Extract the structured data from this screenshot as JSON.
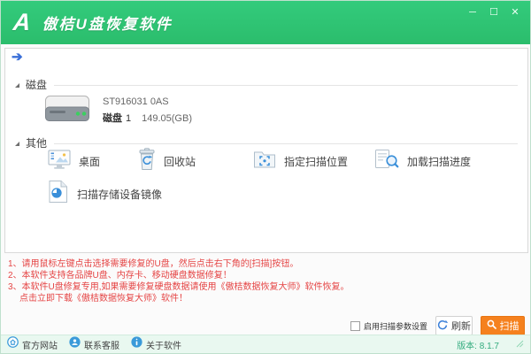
{
  "window": {
    "logo": "A",
    "title": "傲桔U盘恢复软件",
    "controls": {
      "minimize": "─",
      "maximize": "☐",
      "close": "✕"
    }
  },
  "toolbar": {
    "forward_arrow": "➔"
  },
  "sections": {
    "disk": {
      "label": "磁盘",
      "device": {
        "model": "ST916031 0AS",
        "disk_label": "磁盘",
        "disk_number": "1",
        "capacity": "149.05(GB)"
      }
    },
    "other": {
      "label": "其他",
      "items": [
        {
          "label": "桌面",
          "icon": "desktop-icon"
        },
        {
          "label": "回收站",
          "icon": "recycle-bin-icon"
        },
        {
          "label": "指定扫描位置",
          "icon": "scan-location-icon"
        },
        {
          "label": "加载扫描进度",
          "icon": "load-scan-progress-icon"
        },
        {
          "label": "扫描存储设备镜像",
          "icon": "device-image-icon"
        }
      ]
    }
  },
  "notes": {
    "line1": "1、请用鼠标左键点击选择需要修复的U盘，然后点击右下角的[扫描]按钮。",
    "line2": "2、本软件支持各品牌U盘、内存卡、移动硬盘数据修复！",
    "line3": "3、本软件U盘修复专用,如果需要修复硬盘数据请使用《傲桔数据恢复大师》软件恢复。",
    "line4": "点击立即下载《傲桔数据恢复大师》软件！"
  },
  "actions": {
    "checkbox_label": "启用扫描参数设置",
    "checkbox_checked": false,
    "refresh_label": "刷新",
    "scan_label": "扫描"
  },
  "statusbar": {
    "links": [
      {
        "label": "官方网站",
        "icon": "home-icon"
      },
      {
        "label": "联系客服",
        "icon": "support-icon"
      },
      {
        "label": "关于软件",
        "icon": "about-icon"
      }
    ],
    "version": "版本: 8.1.7"
  },
  "colors": {
    "header_green": "#2EC573",
    "statusbar_bg": "#E9F8F0",
    "version_text": "#33AB7E",
    "scan_button_orange": "#F5811E",
    "warning_red": "#E54545",
    "accent_blue": "#3A8FD9"
  }
}
